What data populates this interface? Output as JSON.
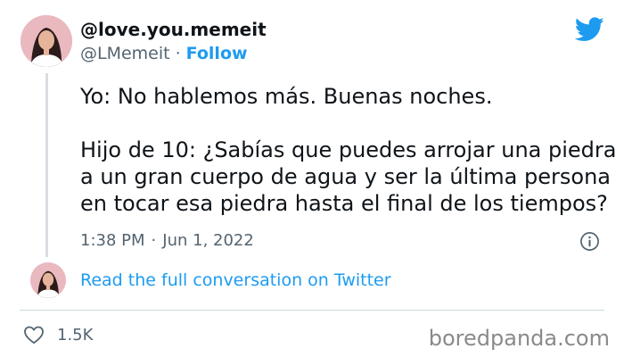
{
  "author": {
    "display_name": "@love.you.memeit",
    "handle": "@LMemeit",
    "separator": "·",
    "follow_label": "Follow"
  },
  "tweet": {
    "line1": "Yo: No hablemos más. Buenas noches.",
    "line2": "Hijo de 10: ¿Sabías que puedes arrojar una piedra",
    "line3": "a un gran cuerpo de agua y ser la última persona",
    "line4": "en tocar esa piedra hasta el final de los tiempos?",
    "time": "1:38 PM",
    "date": "Jun 1, 2022",
    "separator": "·"
  },
  "conversation": {
    "link_label": "Read the full conversation on Twitter"
  },
  "actions": {
    "like_count": "1.5K"
  },
  "watermark": "boredpanda.com",
  "colors": {
    "accent": "#1d9bf0",
    "text": "#0f1419",
    "muted": "#536471",
    "divider": "#cfd9de"
  },
  "icons": [
    "twitter-bird-icon",
    "info-icon",
    "heart-icon",
    "avatar"
  ]
}
